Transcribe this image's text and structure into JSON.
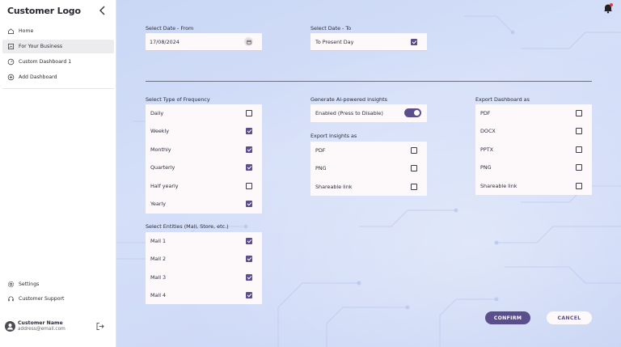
{
  "sidebar": {
    "logo": "Customer Logo",
    "items": [
      {
        "label": "Home",
        "icon": "home-icon"
      },
      {
        "label": "For Your Business",
        "icon": "business-icon"
      },
      {
        "label": "Custom Dashboard 1",
        "icon": "dashboard-icon"
      },
      {
        "label": "Add Dashboard",
        "icon": "plus-circle-icon"
      }
    ],
    "bottom": [
      {
        "label": "Settings",
        "icon": "gear-icon"
      },
      {
        "label": "Customer Support",
        "icon": "headset-icon"
      }
    ],
    "user": {
      "name": "Customer Name",
      "email": "address@email.com"
    }
  },
  "date": {
    "from_label": "Select Date - From",
    "from_value": "17/08/2024",
    "to_label": "Select Date - To",
    "to_value": "To Present Day",
    "to_checked": true
  },
  "frequency": {
    "label": "Select Type of Frequency",
    "options": [
      {
        "label": "Daily",
        "checked": false
      },
      {
        "label": "Weekly",
        "checked": true
      },
      {
        "label": "Monthly",
        "checked": true
      },
      {
        "label": "Quarterly",
        "checked": true
      },
      {
        "label": "Half yearly",
        "checked": false
      },
      {
        "label": "Yearly",
        "checked": true
      }
    ]
  },
  "entities": {
    "label": "Select Entities (Mall, Store, etc.)",
    "options": [
      {
        "label": "Mall 1",
        "checked": true
      },
      {
        "label": "Mall 2",
        "checked": true
      },
      {
        "label": "Mall 3",
        "checked": true
      },
      {
        "label": "Mall 4",
        "checked": true
      }
    ]
  },
  "ai": {
    "label": "Generate AI-powered insights",
    "toggle_text": "Enabled (Press to Disable)",
    "enabled": true
  },
  "export_insights": {
    "label": "Export Insights as",
    "options": [
      {
        "label": "PDF",
        "checked": false
      },
      {
        "label": "PNG",
        "checked": false
      },
      {
        "label": "Shareable link",
        "checked": false
      }
    ]
  },
  "export_dashboard": {
    "label": "Export Dashboard as",
    "options": [
      {
        "label": "PDF",
        "checked": false
      },
      {
        "label": "DOCX",
        "checked": false
      },
      {
        "label": "PPTX",
        "checked": false
      },
      {
        "label": "PNG",
        "checked": false
      },
      {
        "label": "Shareable link",
        "checked": false
      }
    ]
  },
  "actions": {
    "confirm": "CONFIRM",
    "cancel": "CANCEL"
  },
  "colors": {
    "accent": "#5b4e8d",
    "background": "#cfdaf7",
    "card": "#fdf9fb"
  }
}
